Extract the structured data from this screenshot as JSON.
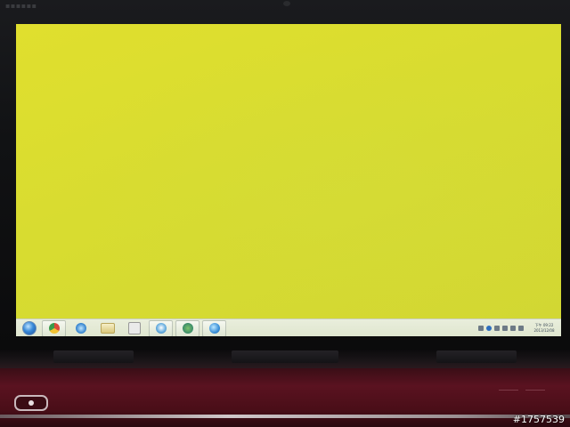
{
  "desktop": {
    "background_color": "#dada2c"
  },
  "taskbar": {
    "start_icon": "windows-orb-icon",
    "pinned": [
      {
        "name": "chrome-icon"
      },
      {
        "name": "internet-explorer-icon"
      },
      {
        "name": "windows-explorer-icon"
      },
      {
        "name": "media-player-icon"
      },
      {
        "name": "network-icon"
      },
      {
        "name": "utility-icon"
      },
      {
        "name": "globe-icon"
      }
    ],
    "clock": {
      "time": "下午 09:22",
      "date": "2013/12/08"
    }
  },
  "watermark": "#1757539"
}
